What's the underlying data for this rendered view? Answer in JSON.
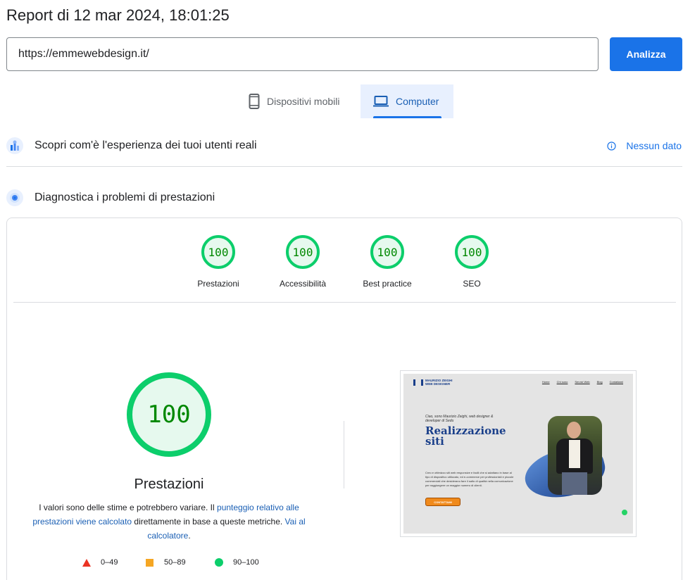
{
  "header": {
    "title": "Report di 12 mar 2024, 18:01:25"
  },
  "url_bar": {
    "value": "https://emmewebdesign.it/",
    "button_label": "Analizza"
  },
  "device_tabs": [
    {
      "label": "Dispositivi mobili",
      "icon": "smartphone-icon",
      "selected": false
    },
    {
      "label": "Computer",
      "icon": "laptop-icon",
      "selected": true
    }
  ],
  "field_data": {
    "label": "Scopri com'è l'esperienza dei tuoi utenti reali",
    "status": "Nessun dato"
  },
  "lab_data": {
    "label": "Diagnostica i problemi di prestazioni"
  },
  "scores": [
    {
      "value": "100",
      "label": "Prestazioni"
    },
    {
      "value": "100",
      "label": "Accessibilità"
    },
    {
      "value": "100",
      "label": "Best practice"
    },
    {
      "value": "100",
      "label": "SEO"
    }
  ],
  "performance": {
    "score": "100",
    "label": "Prestazioni",
    "desc_part1": "I valori sono delle stime e potrebbero variare. Il ",
    "desc_link1": "punteggio relativo alle prestazioni viene calcolato",
    "desc_part2": " direttamente in base a queste metriche. ",
    "desc_link2": "Vai al calcolatore",
    "desc_part3": "."
  },
  "legend": {
    "fail": "0–49",
    "average": "50–89",
    "pass": "90–100"
  },
  "colors": {
    "pass": "#0cce6b",
    "average": "#f5a623",
    "fail": "#eb3323",
    "accent": "#1a73e8"
  },
  "screenshot": {
    "logo_line1": "MAURIZIO ZEIGHI",
    "logo_line2": "WEB DESIGNER",
    "nav": [
      "Home",
      "Chi sono",
      "Servizi Web",
      "Blog",
      "Contattami"
    ],
    "intro": "Ciao, sono Maurizio Zeighi, web designer & developer di Sedu",
    "headline": "Realizzazione siti",
    "body": "Creo e ottimizzo siti web responsive e facili che si adattano in base al tipo di dispositivo utilizzato, ed e-commerce per professionisti e piccole commerciali che desiderano fare il salto di qualità nella comunicazione per raggiungere un maggior numero di clienti.",
    "cta": "CONTATTAMI"
  }
}
